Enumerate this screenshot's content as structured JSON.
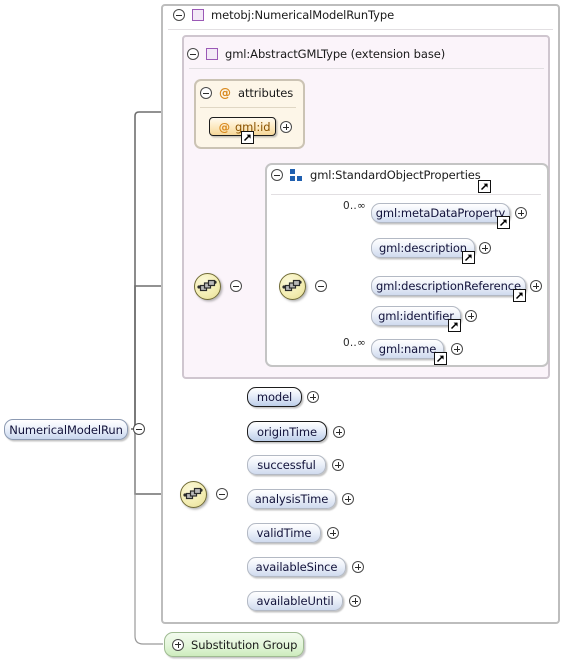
{
  "diagram": {
    "type": "xml-schema-element-diagram",
    "root_element": {
      "label": "NumericalModelRun",
      "kind": "element",
      "use": "root"
    },
    "substitution_group": {
      "label": "Substitution Group",
      "expander": "plus"
    },
    "containers": [
      {
        "id": "type",
        "label": "metobj:NumericalModelRunType",
        "icon": "complex-type-icon",
        "expander": "minus"
      },
      {
        "id": "extbase",
        "label": "gml:AbstractGMLType (extension base)",
        "icon": "complex-type-icon",
        "expander": "minus"
      },
      {
        "id": "attributes",
        "label": "attributes",
        "icon": "at-icon",
        "expander": "minus"
      },
      {
        "id": "sop",
        "label": "gml:StandardObjectProperties",
        "icon": "model-group-icon",
        "expander": "minus",
        "external_ref": true
      }
    ],
    "attribute_nodes": [
      {
        "label": "gml:id",
        "required": true,
        "external_ref": true,
        "expander": "plus"
      }
    ],
    "gml_properties": [
      {
        "label": "gml:metaDataProperty",
        "occurrence": "0..∞",
        "required": false,
        "external_ref": true,
        "expander": "plus"
      },
      {
        "label": "gml:description",
        "occurrence": "",
        "required": false,
        "external_ref": true,
        "expander": "plus"
      },
      {
        "label": "gml:descriptionReference",
        "occurrence": "",
        "required": false,
        "external_ref": true,
        "expander": "plus"
      },
      {
        "label": "gml:identifier",
        "occurrence": "",
        "required": false,
        "external_ref": true,
        "expander": "plus"
      },
      {
        "label": "gml:name",
        "occurrence": "0..∞",
        "required": false,
        "external_ref": true,
        "expander": "plus"
      }
    ],
    "model_run_properties": [
      {
        "label": "model",
        "required": true,
        "external_ref": false,
        "expander": "plus"
      },
      {
        "label": "originTime",
        "required": true,
        "external_ref": false,
        "expander": "plus"
      },
      {
        "label": "successful",
        "required": false,
        "external_ref": false,
        "expander": "plus"
      },
      {
        "label": "analysisTime",
        "required": false,
        "external_ref": false,
        "expander": "plus"
      },
      {
        "label": "validTime",
        "required": false,
        "external_ref": false,
        "expander": "plus"
      },
      {
        "label": "availableSince",
        "required": false,
        "external_ref": false,
        "expander": "plus"
      },
      {
        "label": "availableUntil",
        "required": false,
        "external_ref": false,
        "expander": "plus"
      }
    ],
    "compositors": [
      {
        "id": "seq-ext",
        "kind": "sequence",
        "expander": "minus"
      },
      {
        "id": "seq-sop",
        "kind": "sequence",
        "expander": "minus"
      },
      {
        "id": "seq-body",
        "kind": "sequence",
        "expander": "minus"
      }
    ],
    "colors": {
      "extension_base_bg": "#fbf4fa",
      "attributes_bg": "#fdf6e8",
      "element_fill": "#cfdaee",
      "attribute_fill": "#f6d79a",
      "substitution_fill": "#cdecbd",
      "sequence_fill": "#f4eeb4",
      "complex_type_icon": "#9b59b6",
      "model_group_icon": "#2060b0"
    }
  }
}
